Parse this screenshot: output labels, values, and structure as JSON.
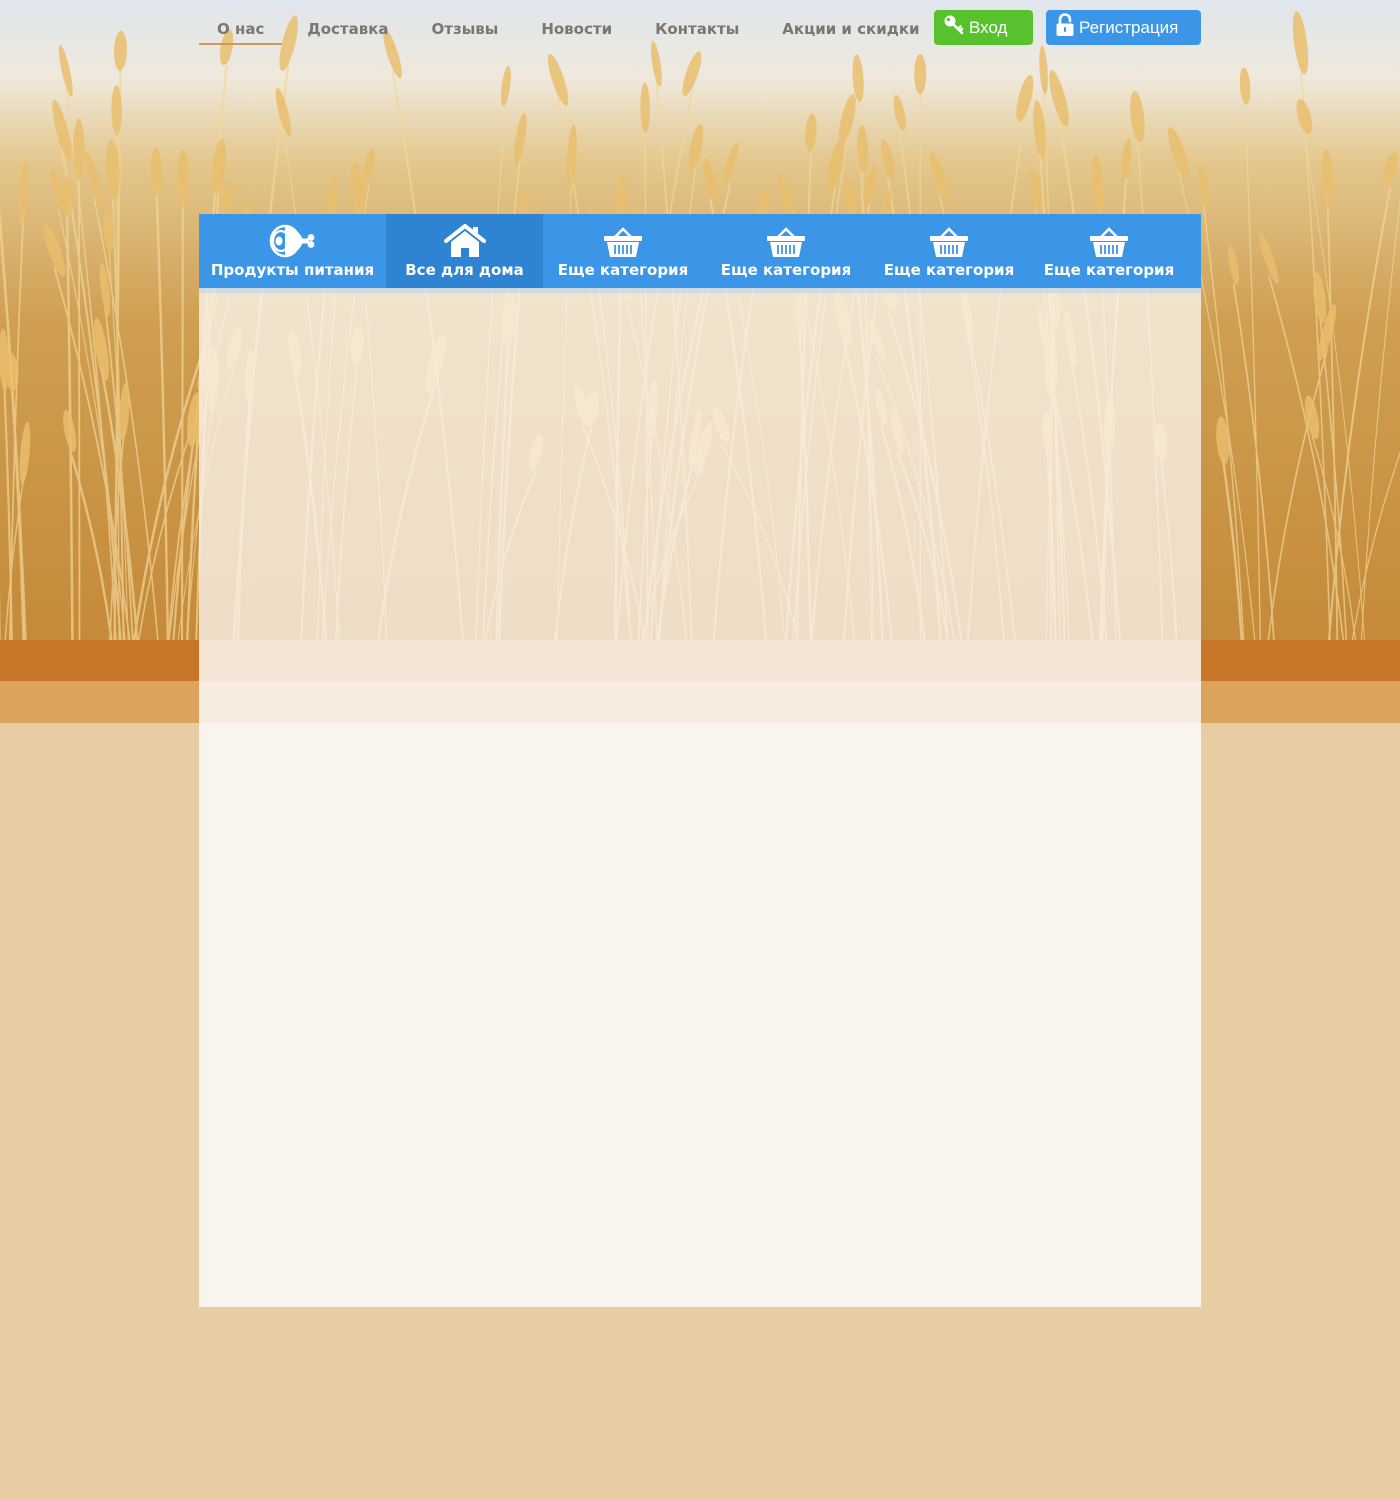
{
  "top_nav": {
    "items": [
      {
        "label": "О нас",
        "active": true
      },
      {
        "label": "Доставка",
        "active": false
      },
      {
        "label": "Отзывы",
        "active": false
      },
      {
        "label": "Новости",
        "active": false
      },
      {
        "label": "Контакты",
        "active": false
      },
      {
        "label": "Акции и скидки",
        "active": false
      }
    ]
  },
  "auth": {
    "login_label": "Вход",
    "register_label": "Регистрация",
    "login_icon": "key-icon",
    "register_icon": "unlock-icon"
  },
  "categories": [
    {
      "label": "Продукты питания",
      "icon": "ham-icon",
      "active": false
    },
    {
      "label": "Все для дома",
      "icon": "house-icon",
      "active": true
    },
    {
      "label": "Еще категория",
      "icon": "basket-icon",
      "active": false
    },
    {
      "label": "Еще категория",
      "icon": "basket-icon",
      "active": false
    },
    {
      "label": "Еще категория",
      "icon": "basket-icon",
      "active": false
    },
    {
      "label": "Еще категория",
      "icon": "basket-icon",
      "active": false
    }
  ],
  "colors": {
    "nav_text": "#7a7670",
    "active_underline": "#c99a5a",
    "login_bg": "#58c12e",
    "register_bg": "#3c96e8",
    "category_bar": "#3c96e8",
    "category_active": "#2e83d3",
    "page_bg": "#e8cca3",
    "band_dark": "#c77628",
    "band_light": "#dba35c"
  }
}
